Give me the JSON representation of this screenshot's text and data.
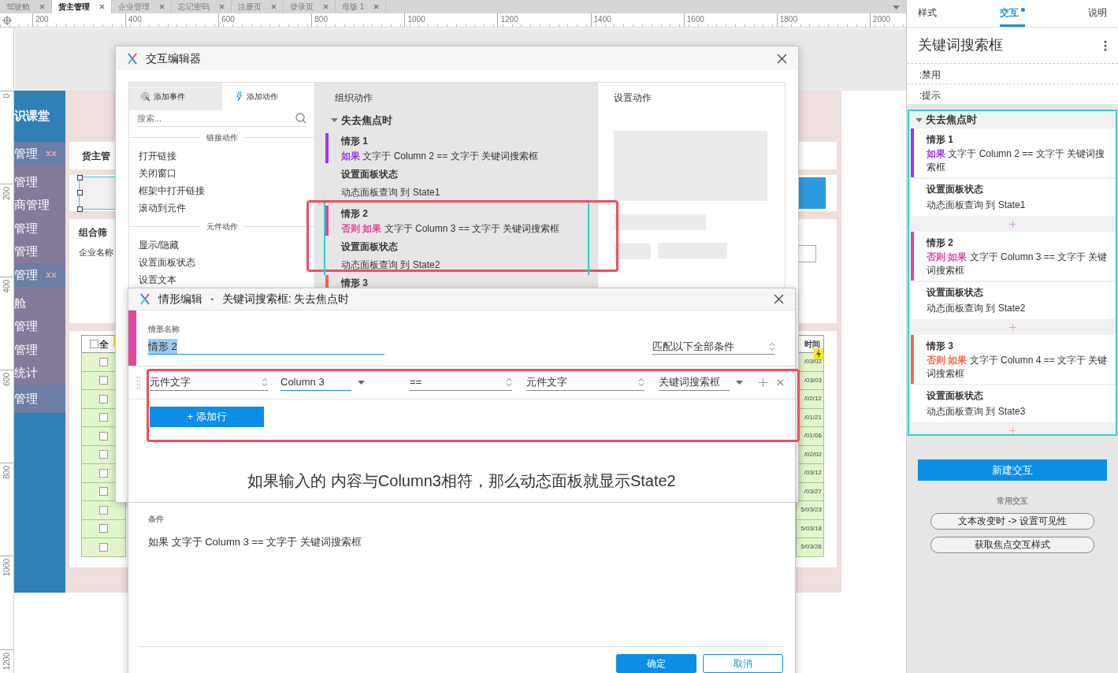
{
  "doc_tabs": [
    {
      "label": "驾驶舱",
      "selected": false
    },
    {
      "label": "货主管理",
      "selected": true
    },
    {
      "label": "企业管理",
      "selected": false
    },
    {
      "label": "忘记密码",
      "selected": false
    },
    {
      "label": "注册页",
      "selected": false
    },
    {
      "label": "登录页",
      "selected": false
    },
    {
      "label": "母版 1",
      "selected": false
    }
  ],
  "ruler_h": [
    "200",
    "400",
    "600",
    "800",
    "1000",
    "1200",
    "1400",
    "1600",
    "1800",
    "2000"
  ],
  "ruler_v": [
    "0",
    "200",
    "400",
    "600",
    "800",
    "1000",
    "1200"
  ],
  "prototype": {
    "brand": "识课堂",
    "menu": [
      {
        "label": "管理",
        "kind": "group",
        "toggle": true
      },
      {
        "label": "管理",
        "kind": "item"
      },
      {
        "label": "商管理",
        "kind": "item"
      },
      {
        "label": "管理",
        "kind": "item"
      },
      {
        "label": "管理",
        "kind": "item"
      },
      {
        "label": "管理",
        "kind": "group",
        "toggle": true
      },
      {
        "label": "舱",
        "kind": "item"
      },
      {
        "label": "管理",
        "kind": "item"
      },
      {
        "label": "管理",
        "kind": "item"
      },
      {
        "label": "统计",
        "kind": "item"
      },
      {
        "label": "管理",
        "kind": "group",
        "toggle": false
      }
    ],
    "page_title": "货主管",
    "filter_title": "组合筛",
    "filter_label": "企业名称",
    "table": {
      "header_checked": false,
      "header_left": "全",
      "header_right": "时间",
      "rows": [
        {
          "checked": false,
          "date": "/03/02"
        },
        {
          "checked": false,
          "date": "/03/03"
        },
        {
          "checked": false,
          "date": "/02/12"
        },
        {
          "checked": false,
          "date": "/01/21"
        },
        {
          "checked": false,
          "date": "/01/06"
        },
        {
          "checked": false,
          "date": "/02/02"
        },
        {
          "checked": false,
          "date": "/03/12"
        },
        {
          "checked": false,
          "date": "/03/27"
        },
        {
          "checked": false,
          "date": "5/03/23"
        },
        {
          "checked": false,
          "date": "5/03/18"
        },
        {
          "checked": false,
          "date": "5/03/26"
        }
      ]
    }
  },
  "interaction_editor": {
    "title": "交互编辑器",
    "tabs": [
      {
        "label": "添加事件",
        "kind": "event",
        "selected": false
      },
      {
        "label": "添加动作",
        "kind": "action",
        "selected": true
      }
    ],
    "search_placeholder": "搜索...",
    "groups": [
      {
        "title": "链接动作",
        "items": [
          "打开链接",
          "关闭窗口",
          "框架中打开链接",
          "滚动到元件"
        ]
      },
      {
        "title": "元件动作",
        "items": [
          "显示/隐藏",
          "设置面板状态",
          "设置文本"
        ]
      }
    ],
    "organize_title": "组织动作",
    "event": "失去焦点时",
    "cases": [
      {
        "name": "情形 1",
        "prefix": "如果",
        "condition": "文字于 Column 2 == 文字于 关键词搜索框",
        "color": "#a335ee",
        "action": "设置面板状态",
        "detail": "动态面板查询 到 State1",
        "selected": false
      },
      {
        "name": "情形 2",
        "prefix": "否则 如果",
        "condition": "文字于 Column 3 == 文字于 关键词搜索框",
        "color": "#e2469f",
        "action": "设置面板状态",
        "detail": "动态面板查询 到 State2",
        "selected": true
      },
      {
        "name": "情形 3",
        "color": "#f4683f",
        "selected": false
      }
    ],
    "settings_title": "设置动作"
  },
  "case_editor": {
    "title": "情形编辑",
    "separator": "-",
    "subtitle": "关键词搜索框: 失去焦点时",
    "name_label": "情形名称",
    "name_value": "情形 2",
    "name_selected": true,
    "color": "#e2469f",
    "match": "匹配以下全部条件",
    "fields": [
      {
        "value": "元件文字",
        "kind": "spinner",
        "focused": false
      },
      {
        "value": "Column 3",
        "kind": "dropdown",
        "focused": true
      },
      {
        "value": "==",
        "kind": "spinner",
        "focused": false
      },
      {
        "value": "元件文字",
        "kind": "spinner",
        "focused": false
      },
      {
        "value": "关键词搜索框",
        "kind": "dropdown",
        "focused": false
      }
    ],
    "add_row": "+ 添加行",
    "annotation": "如果输入的 内容与Column3相符，那么动态面板就显示State2",
    "conditions_label": "条件",
    "conditions_text": "如果 文字于 Column 3 == 文字于 关键词搜索框",
    "buttons": [
      {
        "label": "确定",
        "kind": "primary"
      },
      {
        "label": "取消",
        "kind": "secondary"
      }
    ]
  },
  "inspector": {
    "tabs": [
      {
        "label": "样式",
        "selected": false,
        "dot": false
      },
      {
        "label": "交互",
        "selected": true,
        "dot": true
      },
      {
        "label": "说明",
        "selected": false,
        "dot": false
      }
    ],
    "title": "关键词搜索框",
    "states": [
      ":禁用",
      ":提示"
    ],
    "event": "失去焦点时",
    "cases": [
      {
        "name": "情形 1",
        "prefix": "如果",
        "condition": "文字于 Column 2 == 文字于 关键词搜索框",
        "color": "#a335ee",
        "action": "设置面板状态",
        "detail": "动态面板查询 到 State1"
      },
      {
        "name": "情形 2",
        "prefix": "否则 如果",
        "condition": "文字于 Column 3 == 文字于 关键词搜索框",
        "color": "#e2469f",
        "action": "设置面板状态",
        "detail": "动态面板查询 到 State2"
      },
      {
        "name": "情形 3",
        "prefix": "否则 如果",
        "condition": "文字于 Column 4 == 文字于 关键词搜索框",
        "color": "#f4683f",
        "action": "设置面板状态",
        "detail": "动态面板查询 到 State3"
      }
    ],
    "new_button": "新建交互",
    "common_label": "常用交互",
    "common": [
      "文本改变时 -> 设置可见性",
      "获取焦点交互样式"
    ]
  }
}
